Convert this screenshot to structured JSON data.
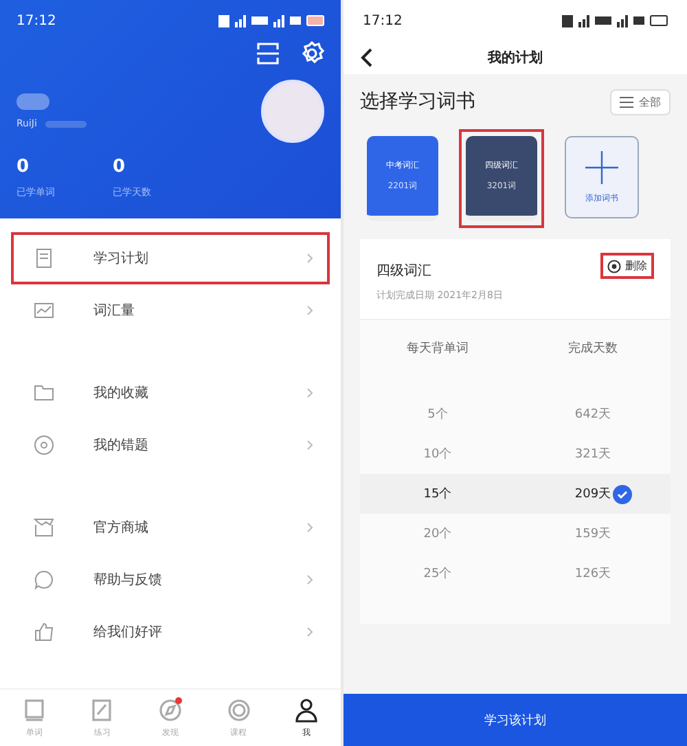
{
  "left_screen": {
    "status_bar": {
      "time": "17:12"
    },
    "profile": {
      "user_id": "RuiJi"
    },
    "stats": [
      {
        "value": "0",
        "label": "已学单词"
      },
      {
        "value": "0",
        "label": "已学天数"
      }
    ],
    "menu_groups": [
      [
        {
          "label": "学习计划",
          "highlighted": true
        },
        {
          "label": "词汇量",
          "highlighted": false
        }
      ],
      [
        {
          "label": "我的收藏",
          "highlighted": false
        },
        {
          "label": "我的错题",
          "highlighted": false
        }
      ],
      [
        {
          "label": "官方商城",
          "highlighted": false
        },
        {
          "label": "帮助与反馈",
          "highlighted": false
        },
        {
          "label": "给我们好评",
          "highlighted": false
        }
      ]
    ],
    "bottom_nav": [
      {
        "label": "单词",
        "selected": false,
        "badge": false
      },
      {
        "label": "练习",
        "selected": false,
        "badge": false
      },
      {
        "label": "发现",
        "selected": false,
        "badge": true
      },
      {
        "label": "课程",
        "selected": false,
        "badge": false
      },
      {
        "label": "我",
        "selected": true,
        "badge": false
      }
    ]
  },
  "right_screen": {
    "status_bar": {
      "time": "17:12"
    },
    "title": "我的计划",
    "section_title": "选择学习词书",
    "all_button": "全部",
    "books": [
      {
        "kind": "book",
        "name": "中考词汇",
        "count": "2201词",
        "color": "#2f66e8",
        "highlighted": false
      },
      {
        "kind": "book",
        "name": "四级词汇",
        "count": "3201词",
        "color": "#3a4a6e",
        "highlighted": true
      },
      {
        "kind": "add",
        "name": "添加词书",
        "highlighted": false
      }
    ],
    "plan": {
      "book_name": "四级词汇",
      "deadline": "计划完成日期 2021年2月8日",
      "delete_label": "删除",
      "delete_highlighted": true,
      "columns": [
        "每天背单词",
        "完成天数"
      ],
      "rows": [
        {
          "words": "5个",
          "days": "642天",
          "selected": false
        },
        {
          "words": "10个",
          "days": "321天",
          "selected": false
        },
        {
          "words": "15个",
          "days": "209天",
          "selected": true
        },
        {
          "words": "20个",
          "days": "159天",
          "selected": false
        },
        {
          "words": "25个",
          "days": "126天",
          "selected": false
        }
      ]
    },
    "submit_button": "学习该计划"
  }
}
